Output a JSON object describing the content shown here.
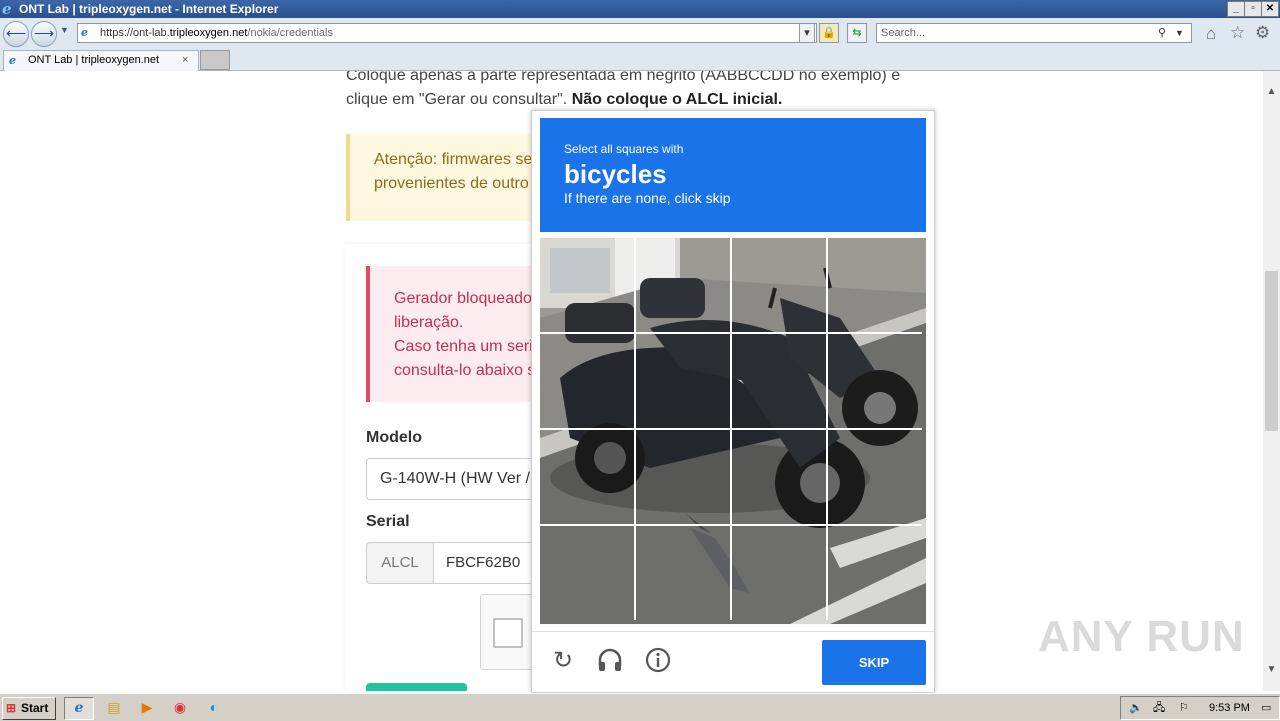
{
  "browser": {
    "window_title": "ONT Lab | tripleoxygen.net - Internet Explorer",
    "url_prefix": "https://ont-lab.",
    "url_domain": "tripleoxygen.net",
    "url_path": "/nokia/credentials",
    "search_placeholder": "Search...",
    "tab_title": "ONT Lab | tripleoxygen.net",
    "tab_close": "×"
  },
  "page": {
    "intro_line1": "Coloque apenas a parte representada em negrito (AABBCCDD no exemplo) e",
    "intro_line2_a": "clique em \"Gerar ou consultar\". ",
    "intro_line2_b": "Não coloque o ALCL inicial.",
    "warning_line1": "Atenção: firmwares ser",
    "warning_line2": "provenientes de outro",
    "danger_line1": "Gerador bloqueado",
    "danger_line2": "liberação.",
    "danger_line3": "Caso tenha um seria",
    "danger_line4": "consulta-lo abaixo s",
    "model_label": "Modelo",
    "model_value": "G-140W-H (HW Ver /",
    "serial_label": "Serial",
    "serial_prefix": "ALCL",
    "serial_value": "FBCF62B0"
  },
  "captcha": {
    "instruction": "Select all squares with",
    "target": "bicycles",
    "hint": "If there are none, click skip",
    "skip_label": "SKIP",
    "grid_size": 4
  },
  "taskbar": {
    "start_label": "Start",
    "clock": "9:53 PM"
  },
  "watermark": "ANY RUN"
}
